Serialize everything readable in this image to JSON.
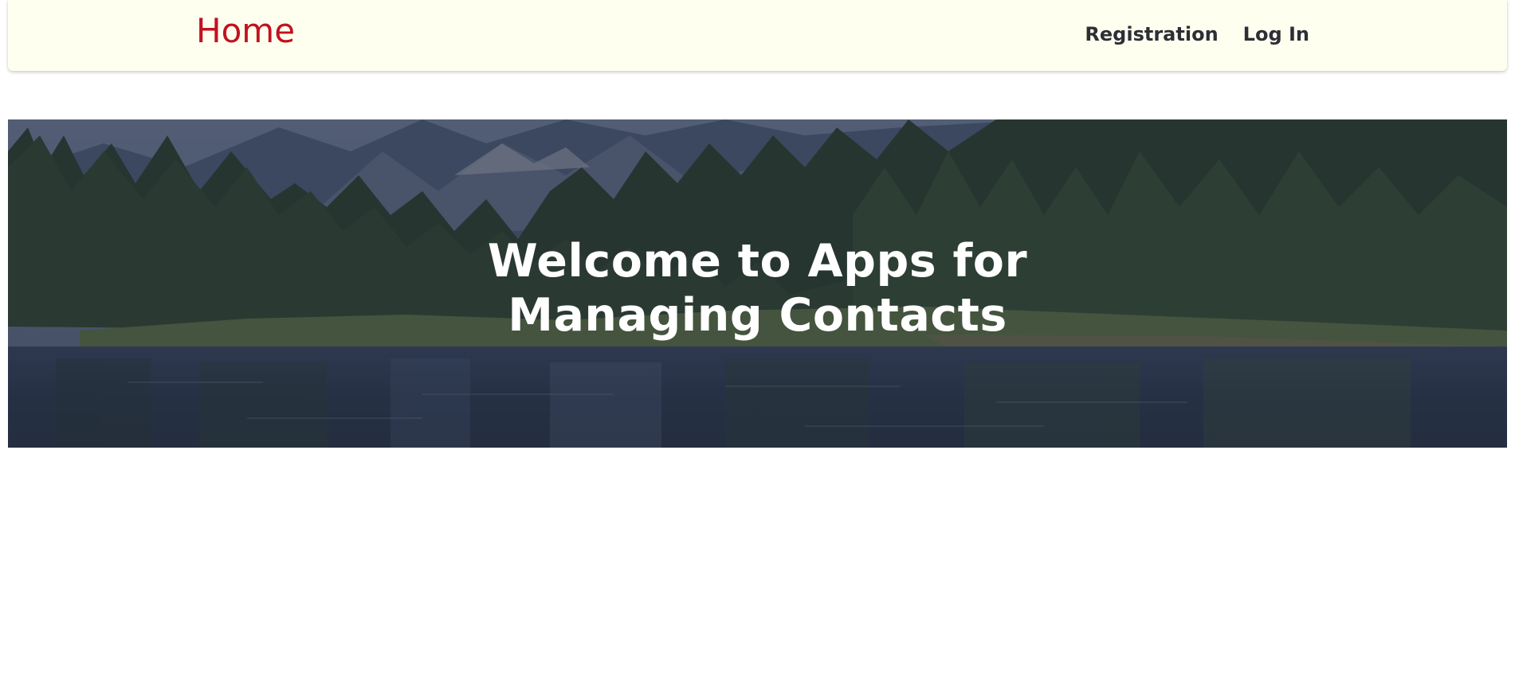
{
  "navbar": {
    "brand": "Home",
    "links": [
      {
        "label": "Registration"
      },
      {
        "label": "Log In"
      }
    ]
  },
  "hero": {
    "title": "Welcome to Apps for Managing Contacts"
  },
  "colors": {
    "brand": "#c1121f",
    "navbar_bg": "#fffff0",
    "nav_link": "#2d2f36"
  }
}
